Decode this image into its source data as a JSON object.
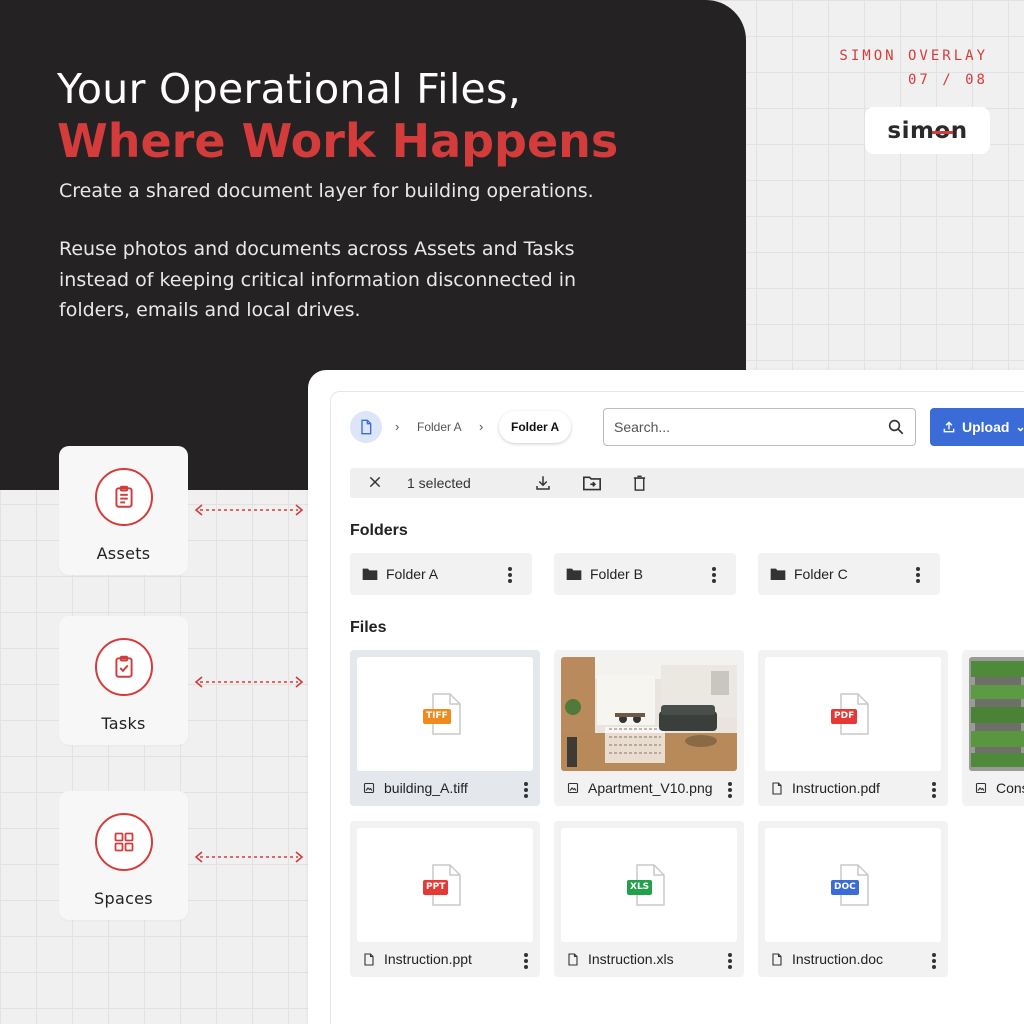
{
  "hero": {
    "title": "Your Operational Files,",
    "accent": "Where Work Happens",
    "subtitle": "Create a shared document layer for building operations.",
    "body": "Reuse photos and documents across Assets and Tasks instead of keeping critical information disconnected in folders, emails and local drives."
  },
  "series": {
    "name": "SIMON OVERLAY",
    "page": "07 / 08"
  },
  "logo": {
    "text_pre": "sim",
    "text_o": "o",
    "text_post": "n"
  },
  "side_items": [
    {
      "label": "Assets",
      "icon": "clipboard-icon"
    },
    {
      "label": "Tasks",
      "icon": "task-check-icon"
    },
    {
      "label": "Spaces",
      "icon": "grid-icon"
    }
  ],
  "toolbar": {
    "breadcrumb": [
      "Folder A",
      "Folder A"
    ],
    "search_placeholder": "Search...",
    "upload_label": "Upload",
    "selected_text": "1 selected"
  },
  "folders_heading": "Folders",
  "folders": [
    "Folder A",
    "Folder B",
    "Folder C"
  ],
  "files_heading": "Files",
  "files": [
    {
      "name": "building_A.tiff",
      "type": "TIFF",
      "color": "#f08a1c",
      "selected": true
    },
    {
      "name": "Apartment_V10.png",
      "type": "image",
      "selected": false
    },
    {
      "name": "Instruction.pdf",
      "type": "PDF",
      "color": "#e53935"
    },
    {
      "name": "Cons",
      "type": "image"
    },
    {
      "name": "Instruction.ppt",
      "type": "PPT",
      "color": "#e53935"
    },
    {
      "name": "Instruction.xls",
      "type": "XLS",
      "color": "#22a04b"
    },
    {
      "name": "Instruction.doc",
      "type": "DOC",
      "color": "#3b6bd6"
    }
  ],
  "colors": {
    "accent": "#d43c3c",
    "dark": "#242223",
    "primary": "#3b6bd6"
  }
}
